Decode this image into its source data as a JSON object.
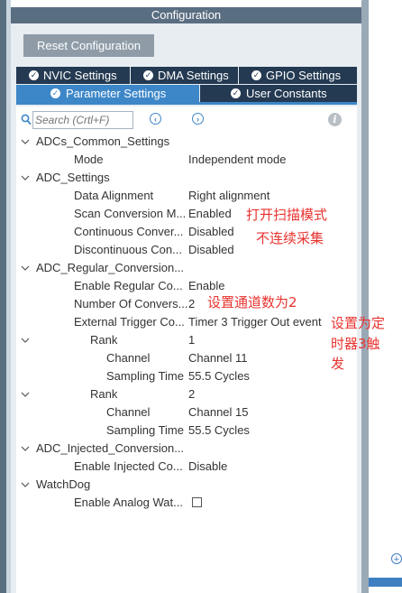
{
  "window": {
    "title": "Configuration"
  },
  "toolbar": {
    "reset_label": "Reset Configuration"
  },
  "tabs": [
    {
      "label": "NVIC Settings",
      "active": false
    },
    {
      "label": "DMA Settings",
      "active": false
    },
    {
      "label": "GPIO Settings",
      "active": false
    },
    {
      "label": "Parameter Settings",
      "active": true
    },
    {
      "label": "User Constants",
      "active": false
    }
  ],
  "search": {
    "placeholder": "Search (Crtl+F)"
  },
  "tree": [
    {
      "label": "ADCs_Common_Settings",
      "value": ""
    },
    {
      "label": "Mode",
      "value": "Independent mode"
    },
    {
      "label": "ADC_Settings",
      "value": ""
    },
    {
      "label": "Data Alignment",
      "value": "Right alignment"
    },
    {
      "label": "Scan Conversion M...",
      "value": "Enabled"
    },
    {
      "label": "Continuous Conver...",
      "value": "Disabled"
    },
    {
      "label": "Discontinuous Con...",
      "value": "Disabled"
    },
    {
      "label": "ADC_Regular_Conversion...",
      "value": ""
    },
    {
      "label": "Enable Regular Co...",
      "value": "Enable"
    },
    {
      "label": "Number Of Convers...",
      "value": "2"
    },
    {
      "label": "External Trigger Co...",
      "value": "Timer 3 Trigger Out event"
    },
    {
      "label": "Rank",
      "value": "1"
    },
    {
      "label": "Channel",
      "value": "Channel 11"
    },
    {
      "label": "Sampling Time",
      "value": "55.5 Cycles"
    },
    {
      "label": "Rank",
      "value": "2"
    },
    {
      "label": "Channel",
      "value": "Channel 15"
    },
    {
      "label": "Sampling Time",
      "value": "55.5 Cycles"
    },
    {
      "label": "ADC_Injected_Conversion...",
      "value": ""
    },
    {
      "label": "Enable Injected Co...",
      "value": "Disable"
    },
    {
      "label": "WatchDog",
      "value": ""
    },
    {
      "label": "Enable Analog Wat...",
      "value": ""
    }
  ],
  "annotations": {
    "scan_note": "打开扫描模式",
    "continuous_note": "不连续采集",
    "rank_note": "设置通道数为2",
    "trigger_note_1": "设置为定",
    "trigger_note_2": "时器3触",
    "trigger_note_3": "发"
  },
  "colors": {
    "accent": "#3d87c8",
    "tab_dark": "#243a52",
    "annotation": "#e8332f",
    "title_bar": "#5a6e82"
  }
}
